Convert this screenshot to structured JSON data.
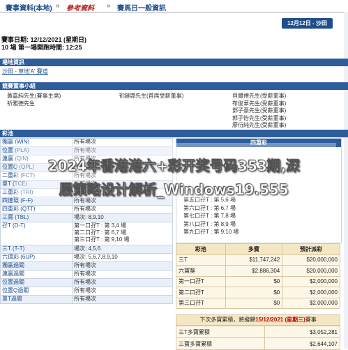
{
  "breadcrumb": {
    "item1": "賽事資料(本地)",
    "sep1": "»",
    "item2": "參考資料",
    "sep2": "»",
    "item3": "賽馬日一般資訊"
  },
  "date_button": "12月12日 - 沙田",
  "meta": {
    "race_date": "賽事日期: 12/12/2021 (星期日)",
    "races": "10 場 第一場開跑時間: 12:25"
  },
  "venue": {
    "heading": "場地資訊",
    "value": "沙田 - 草地'A' 賽道"
  },
  "stewards": {
    "heading": "競賽董事小組",
    "col1": [
      "黃嘉純先生(賽事主席)",
      "祈雅德先生"
    ],
    "col2": [
      "祁鏈譚先生(首席受薪董事)"
    ],
    "col3": [
      "貝爾禮先生(受薪董事)",
      "布俊華先生(受薪董事)",
      "鄧子豪先生(受薪董事)",
      "郭子怡先生(受薪董事)",
      "廖衍純先生(受薪董事)"
    ]
  },
  "pools": {
    "heading": "彩池",
    "rows": [
      {
        "name": "獨贏 (WIN)",
        "desc": "所有場次"
      },
      {
        "name": "位置 (PLA)",
        "desc": "所有場次"
      },
      {
        "name": "連贏 (QIN)",
        "desc": "所有場次"
      },
      {
        "name": "位置Q (QPL)",
        "desc": "所有場次"
      },
      {
        "name": "二重彩 (FCT)",
        "desc": "所有場次"
      },
      {
        "name": "單T (TCE)",
        "desc": "所有場次"
      },
      {
        "name": "三重彩 (TRI)",
        "desc": "所有場次"
      },
      {
        "name": "四連環 (F-F)",
        "desc": "所有場次"
      },
      {
        "name": "四重彩 (QTT)",
        "desc": "所有場次"
      },
      {
        "name": "三寶 (TBL)",
        "desc": "場次: 8,9,10"
      },
      {
        "name": "孖T (D-T)",
        "desc": "第一口孖T : 第 3,4 場\n第二口孖T : 第 6,7 場\n第三口孖T : 第 9,10 場"
      },
      {
        "name": "三T (T-T)",
        "desc": "場次: 4,5,6"
      },
      {
        "name": "六環彩 (6UP)",
        "desc": "場次: 5,6,7,8,9,10"
      },
      {
        "name": "獨贏過關",
        "desc": "所有場次"
      },
      {
        "name": "連贏過關",
        "desc": "所有場次"
      },
      {
        "name": "位置過關",
        "desc": "所有場次"
      },
      {
        "name": "位置Q過關",
        "desc": "所有場次"
      },
      {
        "name": "單T過關",
        "desc": "所有場次"
      }
    ]
  },
  "right_box": {
    "heading": "四重彩",
    "rows": [
      "第五口孖T : 第 5,6 場",
      "第六口孖T : 第 6,7 場",
      "第七口孖T : 第 7,8 場",
      "第八口孖T : 第 8,9 場",
      "第九口孖T : 第 9,10 場"
    ]
  },
  "jackpots": {
    "headers": [
      "彩池",
      "多寶",
      "預計派彩"
    ],
    "rows": [
      {
        "pool": "三T",
        "jackpot": "$11,747,242",
        "estimate": "$20,000,000"
      },
      {
        "pool": "六寶獎",
        "jackpot": "$2,886,304",
        "estimate": "$20,000,000"
      },
      {
        "pool": "第一口孖T",
        "jackpot": "$0",
        "estimate": "$2,000,000"
      },
      {
        "pool": "第二口孖T",
        "jackpot": "$0",
        "estimate": "$2,000,000"
      },
      {
        "pool": "第三口孖T",
        "jackpot": "$0",
        "estimate": "$2,000,000"
      }
    ]
  },
  "carryover": {
    "title_prefix": "下次多寶累積，將撥歸",
    "title_date": "15/12/2021 (星期三)",
    "title_suffix": "賽事",
    "rows": [
      {
        "pool": "三T多寶累積",
        "amount": "$3,052,281"
      },
      {
        "pool": "三寶多寶累積",
        "amount": "$2,644,107"
      }
    ]
  },
  "overlay": {
    "line1": "2024年香港港六+彩开奖号码353期,深",
    "line2": "层策略设计解析_Windows19.555"
  }
}
